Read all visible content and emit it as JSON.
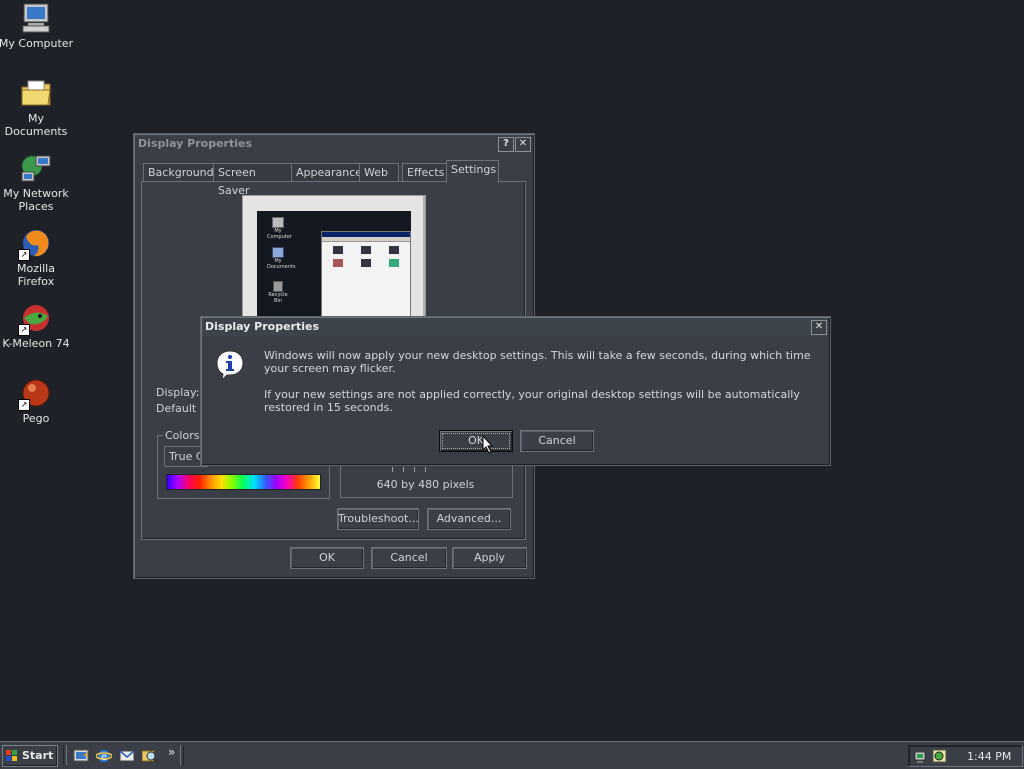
{
  "desktop": {
    "icons": [
      {
        "label": "My Computer",
        "icon": "computer-icon"
      },
      {
        "label": "My Documents",
        "icon": "folder-icon"
      },
      {
        "label": "My Network Places",
        "icon": "network-icon"
      },
      {
        "label": "Mozilla Firefox",
        "icon": "firefox-icon"
      },
      {
        "label": "K-Meleon 74",
        "icon": "kmeleon-icon"
      },
      {
        "label": "Pego",
        "icon": "pego-icon"
      }
    ]
  },
  "display_properties": {
    "title": "Display Properties",
    "help_btn": "?",
    "close_btn": "✕",
    "tabs": [
      "Background",
      "Screen Saver",
      "Appearance",
      "Web",
      "Effects",
      "Settings"
    ],
    "selected_tab": "Settings",
    "display_label": "Display:",
    "display_value": "Default M",
    "colors_label": "Colors",
    "colors_value": "True C",
    "resolution_text": "640 by 480 pixels",
    "troubleshoot_btn": "Troubleshoot...",
    "advanced_btn": "Advanced...",
    "ok_btn": "OK",
    "cancel_btn": "Cancel",
    "apply_btn": "Apply",
    "preview": {
      "icons": [
        "My Computer",
        "My Documents",
        "Recycle Bin"
      ]
    }
  },
  "dialog": {
    "title": "Display Properties",
    "close_btn": "✕",
    "icon": "info-icon",
    "message1": "Windows will now apply your new desktop settings. This will take a few seconds, during which time your screen may flicker.",
    "message2": "If your new settings are not applied correctly, your original desktop settings will be automatically restored in 15 seconds.",
    "ok_btn": "OK",
    "cancel_btn": "Cancel"
  },
  "taskbar": {
    "start_label": "Start",
    "quick_launch": [
      "show-desktop-icon",
      "ie-icon",
      "outlook-icon",
      "search-icon"
    ],
    "chevron": "»",
    "clock": "1:44 PM"
  },
  "colors": {
    "desktop": "#1e2228",
    "window": "#3a3f47",
    "accent": "#e9ecef"
  }
}
